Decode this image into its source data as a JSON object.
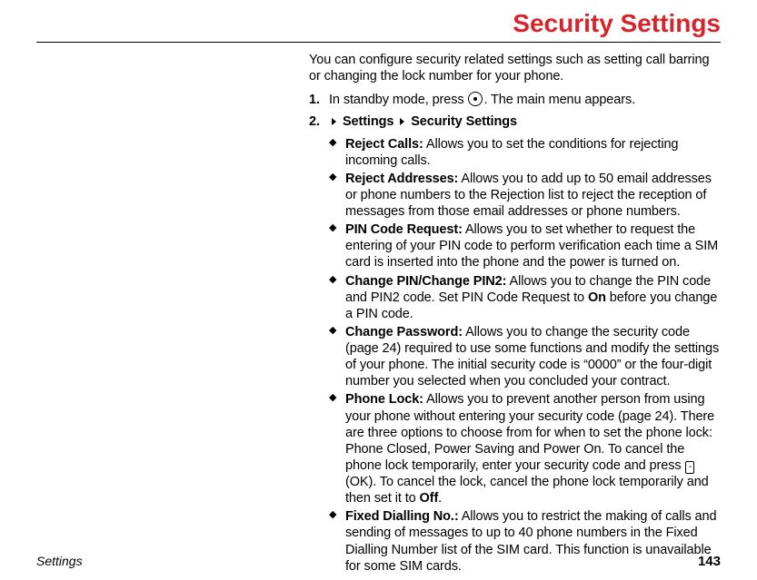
{
  "title": "Security Settings",
  "intro": "You can configure security related settings such as setting call barring or changing the lock number for your phone.",
  "steps": {
    "s1_a": "In standby mode, press ",
    "s1_b": ". The main menu appears.",
    "s2_nav1": "Settings",
    "s2_nav2": "Security Settings"
  },
  "features": {
    "reject_calls_label": "Reject Calls:",
    "reject_calls_text": " Allows you to set the conditions for rejecting incoming calls.",
    "reject_addr_label": "Reject Addresses:",
    "reject_addr_text": " Allows you to add up to 50 email addresses or phone numbers to the Rejection list to reject the reception of messages from those email addresses or phone numbers.",
    "pin_req_label": "PIN Code Request:",
    "pin_req_text": " Allows you to set whether to request the entering of your PIN code to perform verification each time a SIM card is inserted into the phone and the power is turned on.",
    "change_pin_label": "Change PIN/Change PIN2:",
    "change_pin_text_a": " Allows you to change the PIN code and PIN2 code. Set PIN Code Request to ",
    "change_pin_on": "On",
    "change_pin_text_b": " before you change a PIN code.",
    "change_pw_label": "Change Password:",
    "change_pw_text": " Allows you to change the security code (page 24) required to use some functions and modify the settings of your phone. The initial security code is “0000” or the four-digit number you selected when you concluded your contract.",
    "phone_lock_label": "Phone Lock:",
    "phone_lock_text_a": " Allows you to prevent another person from using your phone without entering your security code (page 24). There are three options to choose from for when to set the phone lock: Phone Closed, Power Saving and Power On. To cancel the phone lock temporarily, enter your security code and press ",
    "phone_lock_key": "-",
    "phone_lock_text_b": " (OK). To cancel the lock, cancel the phone lock temporarily and then set it to ",
    "phone_lock_off": "Off",
    "phone_lock_text_c": ".",
    "fixed_dial_label": "Fixed Dialling No.:",
    "fixed_dial_text": " Allows you to restrict the making of calls and sending of messages to up to 40 phone numbers in the Fixed Dialling Number list of the SIM card. This function is unavailable for some SIM cards."
  },
  "footer": {
    "section": "Settings",
    "page": "143"
  }
}
